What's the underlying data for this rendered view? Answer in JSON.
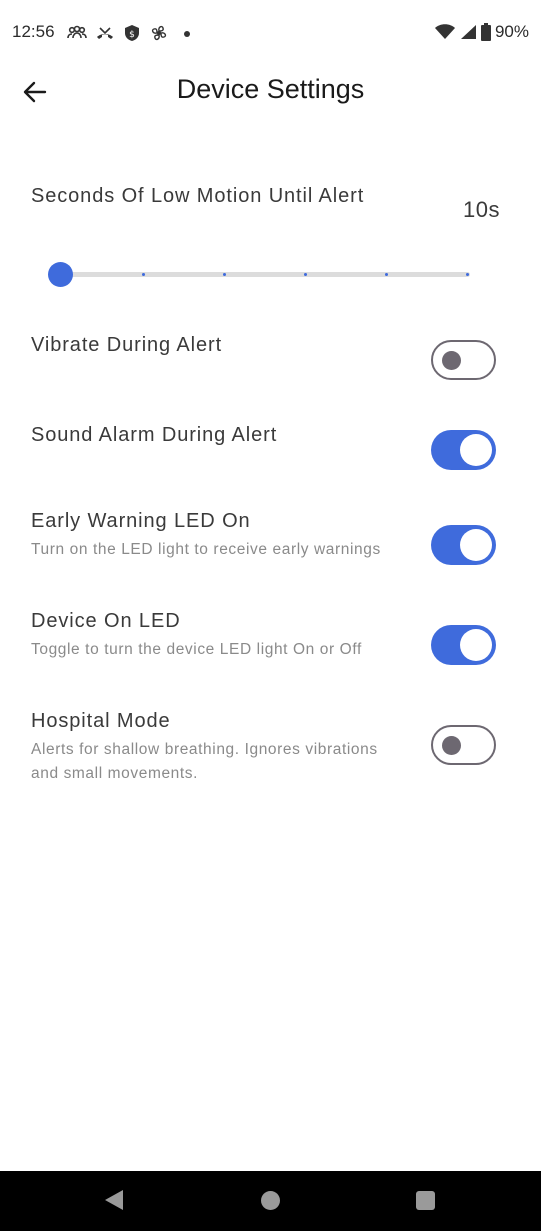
{
  "status_bar": {
    "time": "12:56",
    "battery": "90%",
    "left_icons": [
      "people-icon",
      "missed-call-icon",
      "shield-icon",
      "fan-icon",
      "dot-icon"
    ],
    "right_icons": [
      "wifi-icon",
      "signal-icon",
      "battery-icon"
    ]
  },
  "header": {
    "title": "Device Settings",
    "back_icon": "arrow-left-icon"
  },
  "settings": {
    "low_motion": {
      "label": "Seconds Of Low Motion Until Alert",
      "value": "10s",
      "slider_position": 0,
      "tick_count": 5
    },
    "vibrate": {
      "label": "Vibrate During Alert",
      "enabled": false
    },
    "sound": {
      "label": "Sound Alarm During Alert",
      "enabled": true
    },
    "early_warning": {
      "label": "Early Warning LED On",
      "description": "Turn on the LED light to receive early warnings",
      "enabled": true
    },
    "device_led": {
      "label": "Device On LED",
      "description": "Toggle to turn the device LED light On or Off",
      "enabled": true
    },
    "hospital": {
      "label": "Hospital Mode",
      "description": "Alerts for shallow breathing. Ignores vibrations and small movements.",
      "enabled": false
    }
  },
  "colors": {
    "accent": "#3f6bdc",
    "toggle_off": "#6d6871",
    "text": "#3a3a3a",
    "subtext": "#8a8a8a"
  },
  "nav_bar": {
    "icons": [
      "nav-back-icon",
      "nav-home-icon",
      "nav-recents-icon"
    ]
  }
}
